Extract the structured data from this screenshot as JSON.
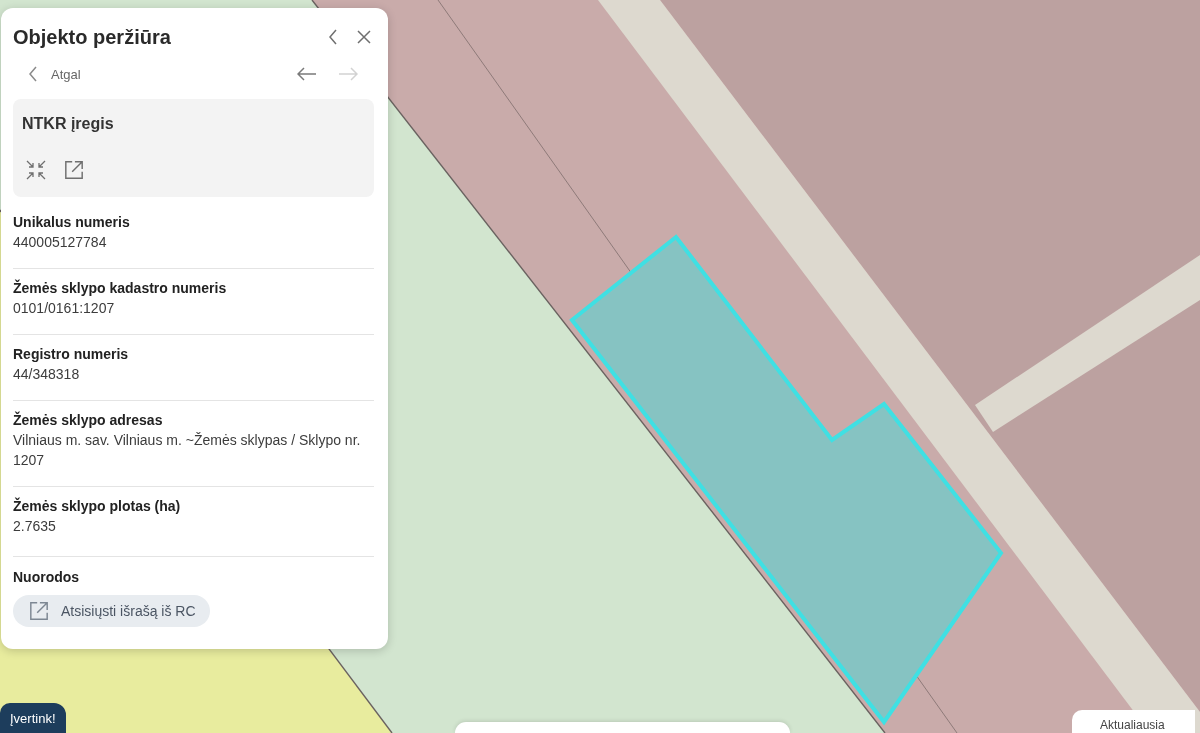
{
  "panel": {
    "title": "Objekto peržiūra",
    "back_link": "Atgal",
    "history": [
      {
        "kind": "back",
        "disabled": false
      },
      {
        "kind": "forward",
        "disabled": true
      }
    ],
    "card": {
      "title": "NTKR įregis"
    },
    "fields": [
      {
        "label": "Unikalus numeris",
        "value": "440005127784"
      },
      {
        "label": "Žemės sklypo kadastro numeris",
        "value": "0101/0161:1207"
      },
      {
        "label": "Registro numeris",
        "value": "44/348318"
      },
      {
        "label": "Žemės sklypo adresas",
        "value": "Vilniaus m. sav. Vilniaus m. ~Žemės sklypas / Sklypo nr. 1207"
      },
      {
        "label": "Žemės sklypo plotas (ha)",
        "value": "2.7635"
      }
    ],
    "links": {
      "label": "Nuorodos",
      "buttons": [
        "Atsisiųsti išrašą iš RC"
      ]
    }
  },
  "feedback_button": "Įvertink!",
  "sort_tab": "Aktualiausia"
}
